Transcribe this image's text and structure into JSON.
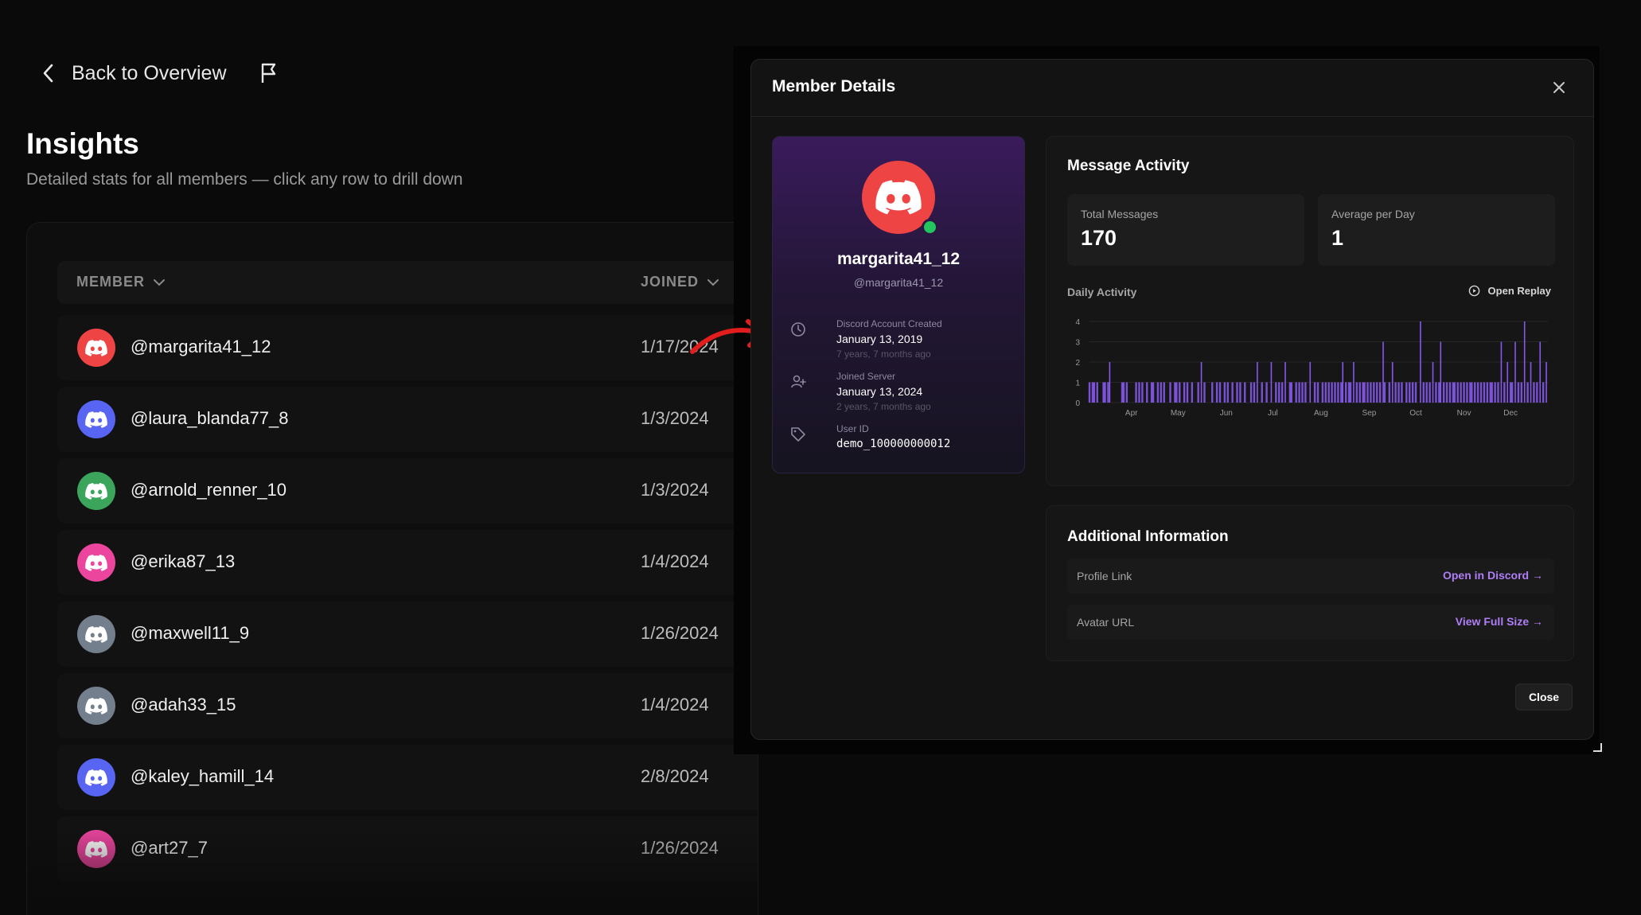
{
  "nav": {
    "back_label": "Back to Overview",
    "back_icon": "chevron-left-icon",
    "flag_icon": "flag-icon"
  },
  "page": {
    "title": "Insights",
    "subtitle": "Detailed stats for all members — click any row to drill down"
  },
  "table": {
    "columns": [
      {
        "label": "MEMBER",
        "icon": "chevron-down-icon"
      },
      {
        "label": "JOINED",
        "icon": "chevron-down-icon"
      }
    ],
    "rows": [
      {
        "handle": "@margarita41_12",
        "joined": "1/17/2024",
        "avatar_color": "#ef4444"
      },
      {
        "handle": "@laura_blanda77_8",
        "joined": "1/3/2024",
        "avatar_color": "#5865f2"
      },
      {
        "handle": "@arnold_renner_10",
        "joined": "1/3/2024",
        "avatar_color": "#3ba55c"
      },
      {
        "handle": "@erika87_13",
        "joined": "1/4/2024",
        "avatar_color": "#eb459e"
      },
      {
        "handle": "@maxwell11_9",
        "joined": "1/26/2024",
        "avatar_color": "#747f8d"
      },
      {
        "handle": "@adah33_15",
        "joined": "1/4/2024",
        "avatar_color": "#747f8d"
      },
      {
        "handle": "@kaley_hamill_14",
        "joined": "2/8/2024",
        "avatar_color": "#5865f2"
      },
      {
        "handle": "@art27_7",
        "joined": "1/26/2024",
        "avatar_color": "#eb459e"
      }
    ]
  },
  "modal": {
    "title": "Member Details",
    "close_icon": "close-icon",
    "profile": {
      "name": "margarita41_12",
      "handle": "@margarita41_12",
      "avatar_color": "#ef4444",
      "status_color": "#22c55e",
      "fields": [
        {
          "label": "Discord Account Created",
          "value": "January 13, 2019",
          "ago": "7 years, 7 months ago",
          "icon": "clock-icon"
        },
        {
          "label": "Joined Server",
          "value": "January 13, 2024",
          "ago": "2 years, 7 months ago",
          "icon": "user-plus-icon"
        },
        {
          "label": "User ID",
          "value": "demo_100000000012",
          "icon": "tag-icon"
        }
      ]
    },
    "activity": {
      "title": "Message Activity",
      "stats": [
        {
          "label": "Total Messages",
          "value": "170"
        },
        {
          "label": "Average per Day",
          "value": "1"
        }
      ],
      "chart_label": "Daily Activity",
      "replay_label": "Open Replay",
      "replay_icon": "play-circle-icon"
    },
    "additional": {
      "title": "Additional Information",
      "rows": [
        {
          "key": "Profile Link",
          "value": "Open in Discord →"
        },
        {
          "key": "Avatar URL",
          "value": "View Full Size →"
        }
      ]
    },
    "close_label": "Close"
  },
  "chart_data": {
    "type": "bar",
    "title": "Daily Activity",
    "ylim": [
      0,
      4
    ],
    "y_ticks": [
      0,
      1,
      2,
      3,
      4
    ],
    "x_tick_labels": [
      "Apr",
      "May",
      "Jun",
      "Jul",
      "Aug",
      "Sep",
      "Oct",
      "Nov",
      "Dec"
    ],
    "x_range_days": [
      0,
      295
    ],
    "x_tick_days": [
      27,
      57,
      88,
      118,
      149,
      180,
      210,
      241,
      271
    ],
    "bar_color": "#8b5cf6",
    "series": [
      {
        "days": [
          0,
          2,
          3,
          5,
          9,
          10,
          12,
          13,
          21,
          22,
          24,
          30,
          32,
          34,
          37,
          40,
          41,
          44,
          46,
          48,
          52,
          55,
          56,
          58,
          61,
          63,
          66,
          70,
          72,
          74,
          79,
          82,
          84,
          87,
          89,
          92,
          95,
          97,
          100,
          104,
          106,
          108,
          111,
          114,
          117,
          120,
          122,
          124,
          126,
          129,
          130,
          133,
          135,
          137,
          139,
          142,
          145,
          147,
          150,
          152,
          154,
          156,
          158,
          160,
          162,
          163,
          165,
          167,
          168,
          170,
          172,
          174,
          176,
          177,
          179,
          181,
          183,
          185,
          187,
          189,
          190,
          193,
          195,
          197,
          199,
          201,
          204,
          206,
          208,
          210,
          213,
          215,
          217,
          219,
          221,
          223,
          225,
          226,
          228,
          230,
          232,
          234,
          235,
          237,
          239,
          241,
          243,
          245,
          246,
          248,
          250,
          252,
          254,
          256,
          258,
          259,
          261,
          263,
          265,
          267,
          269,
          271,
          272,
          274,
          276,
          278,
          280,
          282,
          284,
          286,
          288,
          290,
          292,
          294
        ],
        "values": [
          1,
          1,
          1,
          1,
          1,
          1,
          1,
          2,
          1,
          1,
          1,
          1,
          1,
          1,
          1,
          1,
          1,
          1,
          1,
          1,
          1,
          1,
          1,
          1,
          1,
          1,
          1,
          1,
          2,
          1,
          1,
          1,
          1,
          1,
          1,
          1,
          1,
          1,
          1,
          1,
          1,
          2,
          1,
          1,
          2,
          1,
          1,
          1,
          2,
          1,
          1,
          1,
          1,
          1,
          1,
          2,
          1,
          1,
          1,
          1,
          1,
          1,
          1,
          1,
          1,
          2,
          1,
          1,
          1,
          2,
          1,
          1,
          1,
          1,
          1,
          1,
          1,
          1,
          1,
          3,
          1,
          1,
          2,
          1,
          1,
          1,
          1,
          1,
          1,
          1,
          4,
          1,
          1,
          1,
          2,
          1,
          1,
          3,
          1,
          1,
          1,
          1,
          1,
          1,
          1,
          1,
          1,
          1,
          1,
          1,
          1,
          1,
          1,
          1,
          1,
          1,
          1,
          1,
          3,
          1,
          2,
          1,
          1,
          3,
          1,
          1,
          4,
          1,
          2,
          1,
          1,
          3,
          1,
          2
        ]
      }
    ]
  }
}
